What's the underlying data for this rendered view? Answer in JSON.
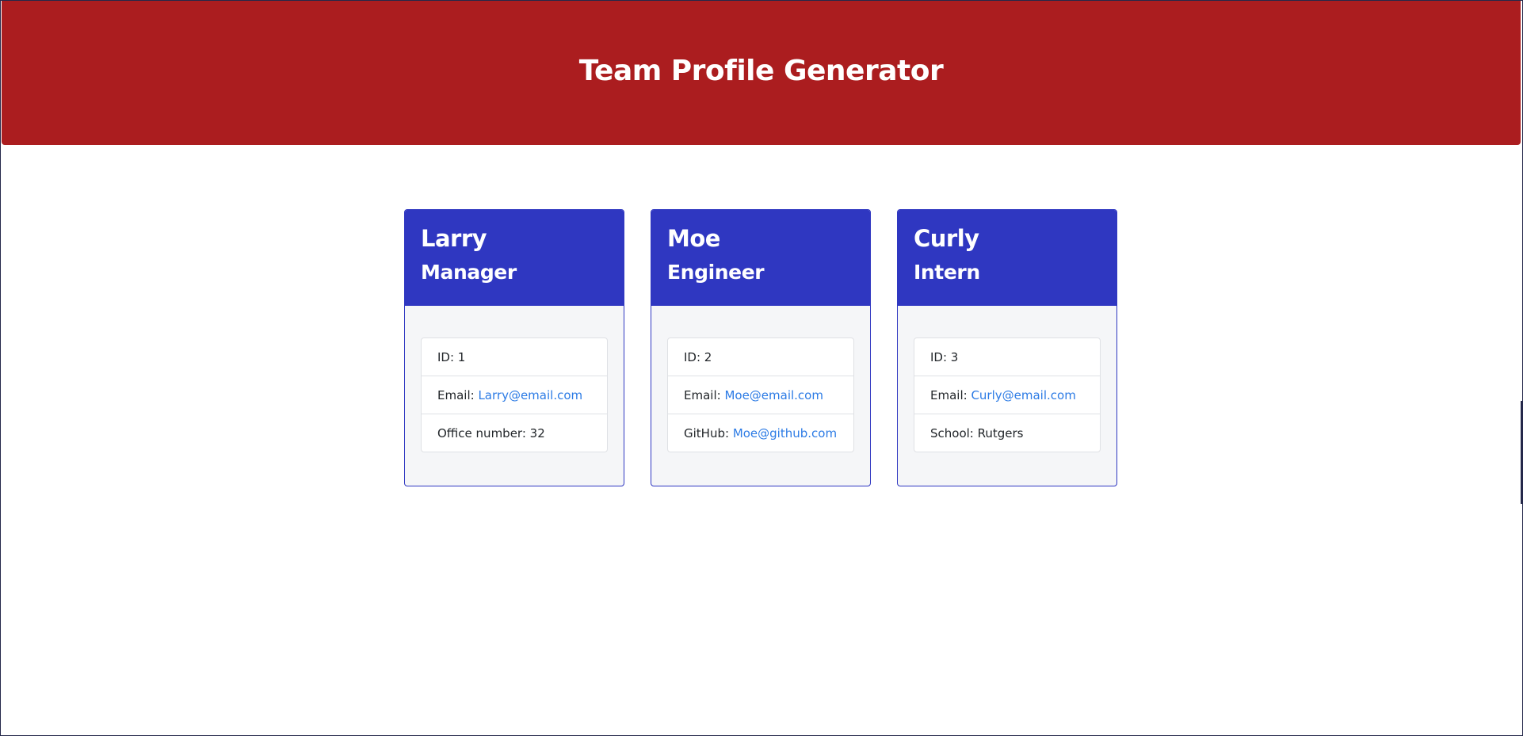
{
  "header": {
    "title": "Team Profile Generator"
  },
  "colors": {
    "header_bg": "#ab1d1f",
    "card_header_bg": "#2f37c1",
    "link": "#2c7be5"
  },
  "cards": [
    {
      "name": "Larry",
      "role": "Manager",
      "id_label": "ID: ",
      "id_value": "1",
      "email_label": "Email: ",
      "email_value": "Larry@email.com",
      "extra_label": "Office number: ",
      "extra_value": "32"
    },
    {
      "name": "Moe",
      "role": "Engineer",
      "id_label": "ID: ",
      "id_value": "2",
      "email_label": "Email: ",
      "email_value": "Moe@email.com",
      "extra_label": "GitHub: ",
      "extra_value": "Moe@github.com"
    },
    {
      "name": "Curly",
      "role": "Intern",
      "id_label": "ID: ",
      "id_value": "3",
      "email_label": "Email: ",
      "email_value": "Curly@email.com",
      "extra_label": "School: ",
      "extra_value": "Rutgers"
    }
  ]
}
